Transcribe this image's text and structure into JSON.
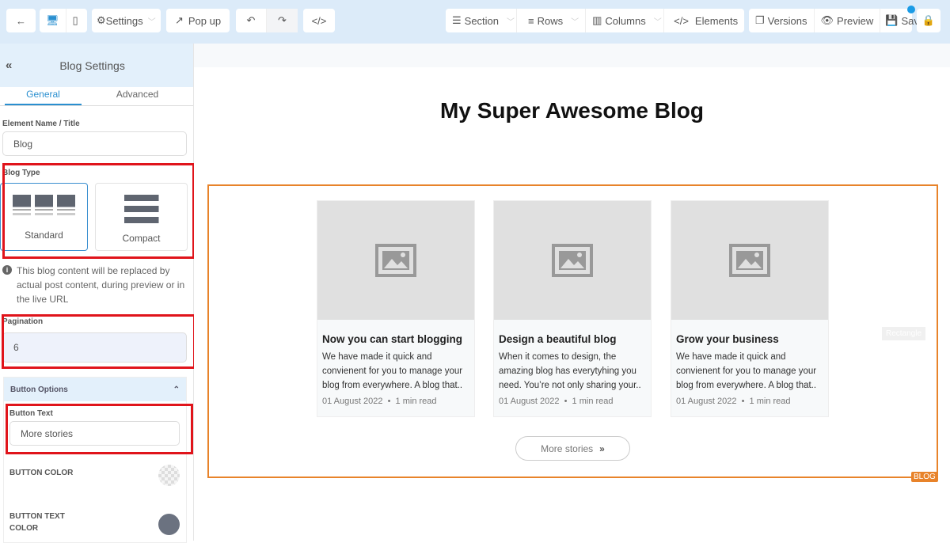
{
  "toolbar": {
    "settings": "Settings",
    "popup": "Pop up",
    "section": "Section",
    "rows": "Rows",
    "columns": "Columns",
    "elements": "Elements",
    "versions": "Versions",
    "preview": "Preview",
    "save": "Save",
    "notify_color": "#1a9be6"
  },
  "sidebar": {
    "title": "Blog Settings",
    "tabs": [
      "General",
      "Advanced"
    ],
    "name_label": "Element Name / Title",
    "name_value": "Blog",
    "blog_type_label": "Blog Type",
    "types": [
      "Standard",
      "Compact"
    ],
    "selected_type": "Standard",
    "info": "This blog content will be replaced by actual post content, during preview or in the live URL",
    "pagination_label": "Pagination",
    "pagination_value": "6",
    "button_options": "Button Options",
    "button_text_label": "Button Text",
    "button_text_value": "More stories",
    "button_color": "BUTTON COLOR",
    "button_text_color": "BUTTON TEXT COLOR",
    "text_color_value": "#6b7280"
  },
  "canvas": {
    "title": "My Super Awesome Blog",
    "tag": "BLOG",
    "rectangle": "Rectangle",
    "accent": "#e8832a",
    "posts": [
      {
        "title": "Now you can start blogging",
        "excerpt": "We have made it quick and convienent for you to manage your blog from everywhere. A blog that..",
        "date": "01 August 2022",
        "read": "1 min read"
      },
      {
        "title": "Design a beautiful blog",
        "excerpt": "When it comes to design, the amazing blog has everytyhing you need. You’re not only sharing your..",
        "date": "01 August 2022",
        "read": "1 min read"
      },
      {
        "title": "Grow your business",
        "excerpt": "We have made it quick and convienent for you to manage your blog from everywhere. A blog that..",
        "date": "01 August 2022",
        "read": "1 min read"
      }
    ],
    "more_button": "More stories"
  }
}
